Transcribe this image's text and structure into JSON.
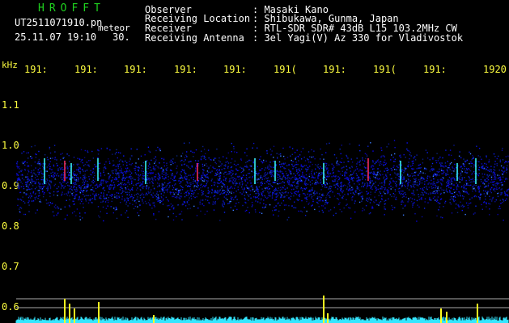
{
  "header": {
    "app_title": "HROFFT",
    "filename": "UT2511071910.pn",
    "meteor_label": "meteor",
    "datetime": "25.11.07 19:10",
    "duration": "30.",
    "fields": [
      {
        "label": "Observer",
        "value": ": Masaki Kano"
      },
      {
        "label": "Receiving Location",
        "value": ": Shibukawa, Gunma, Japan"
      },
      {
        "label": "Receiver",
        "value": ": RTL-SDR SDR# 43dB L15 103.2MHz CW"
      },
      {
        "label": "Receiving Antenna",
        "value": ": 3el Yagi(V) Az 330 for Vladivostok"
      }
    ]
  },
  "axes": {
    "y_unit": "kHz",
    "y_ticks": [
      "1.1",
      "1.0",
      "0.9",
      "0.8",
      "0.7",
      "0.6"
    ],
    "x_ticks": [
      "1911",
      "1912",
      "1913",
      "1914",
      "1915",
      "1916",
      "1917",
      "1918",
      "1919",
      "1920"
    ],
    "x_ticks_visible": [
      "191:",
      "191:",
      "191:",
      "191:",
      "191:",
      "191(",
      "191:",
      "191(",
      "191:",
      "1920"
    ]
  },
  "colors": {
    "background": "#000000",
    "header_text": "#ffffff",
    "title_green": "#1fd11f",
    "axis_yellow": "#ffff40",
    "spectrum_blue": "#1420c8",
    "echo_cyan": "#3cffff",
    "bottom_cyan": "#34e6ff",
    "spike_yellow": "#ffff20"
  }
}
